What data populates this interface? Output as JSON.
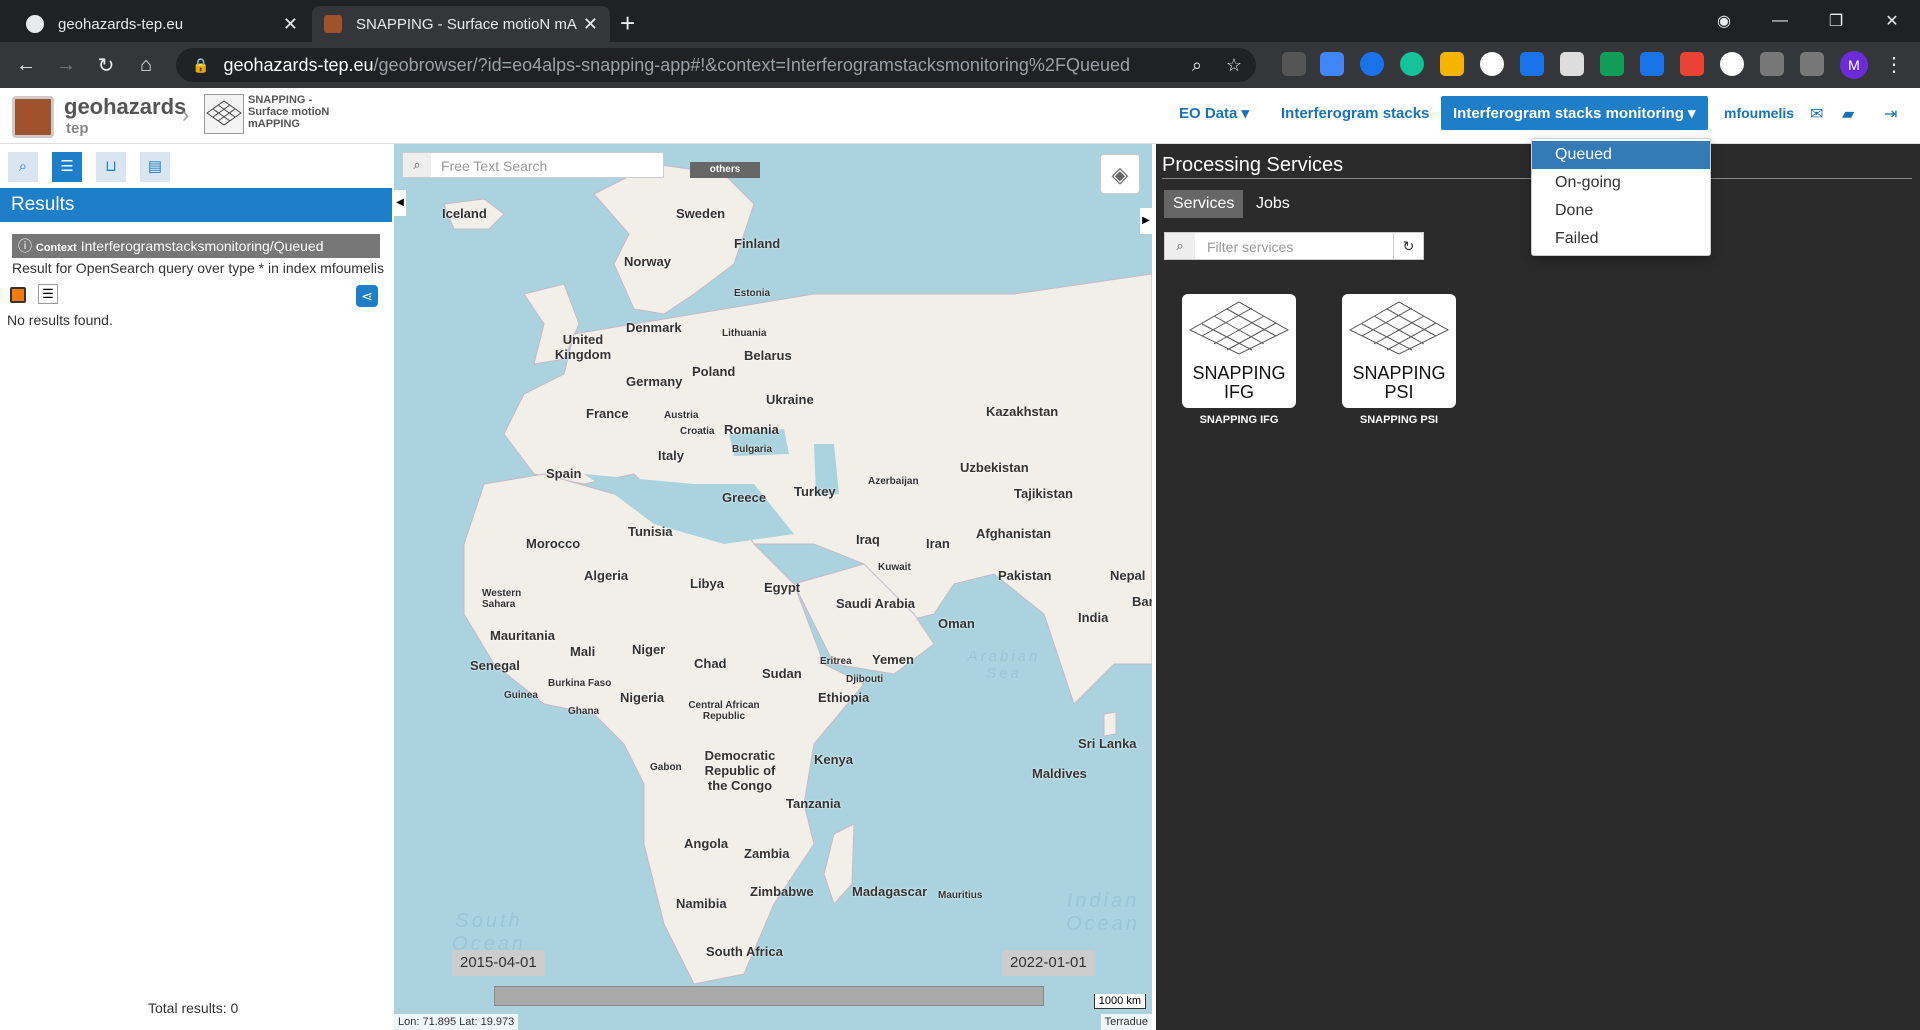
{
  "browser": {
    "tabs": [
      {
        "title": "geohazards-tep.eu"
      },
      {
        "title": "SNAPPING - Surface motioN mAI"
      }
    ],
    "url_host": "geohazards-tep.eu",
    "url_path": "/geobrowser/?id=eo4alps-snapping-app#!&context=Interferogramstacksmonitoring%2FQueued",
    "profile_initial": "M"
  },
  "header": {
    "logo_title": "geohazards",
    "logo_sub": "tep",
    "app_name_line1": "SNAPPING -",
    "app_name_line2": "Surface motioN",
    "app_name_line3": "mAPPING",
    "nav": {
      "eo_data": "EO Data ▾",
      "interferogram_stacks": "Interferogram stacks",
      "monitoring": "Interferogram stacks monitoring ▾",
      "user": "mfoumelis"
    }
  },
  "dropdown": {
    "items": [
      "Queued",
      "On-going",
      "Done",
      "Failed"
    ],
    "selected": "Queued"
  },
  "left": {
    "results_title": "Results",
    "context_prefix": "Context",
    "context_value": "Interferogramstacksmonitoring/Queued",
    "query_text": "Result for OpenSearch query over type * in index mfoumelis",
    "no_results": "No results found.",
    "total": "Total results: 0"
  },
  "map": {
    "search_placeholder": "Free Text Search",
    "others_label": "others",
    "start_date": "2015-04-01",
    "end_date": "2022-01-01",
    "scale": "1000 km",
    "coords": "Lon: 71.895 Lat: 19.973",
    "attribution": "Terradue",
    "labels": [
      "Iceland",
      "Sweden",
      "Finland",
      "Norway",
      "Estonia",
      "Denmark",
      "Lithuania",
      "United Kingdom",
      "Belarus",
      "Poland",
      "Germany",
      "Ukraine",
      "France",
      "Austria",
      "Croatia",
      "Romania",
      "Bulgaria",
      "Italy",
      "Spain",
      "Greece",
      "Turkey",
      "Tunisia",
      "Morocco",
      "Algeria",
      "Libya",
      "Egypt",
      "Iraq",
      "Iran",
      "Kuwait",
      "Saudi Arabia",
      "Oman",
      "Kazakhstan",
      "Uzbekistan",
      "Tajikistan",
      "Afghanistan",
      "Pakistan",
      "Nepal",
      "India",
      "Western Sahara",
      "Mauritania",
      "Mali",
      "Niger",
      "Chad",
      "Sudan",
      "Senegal",
      "Burkina Faso",
      "Guinea",
      "Nigeria",
      "Ghana",
      "Eritrea",
      "Djibouti",
      "Yemen",
      "Ethiopia",
      "Central African Republic",
      "Gabon",
      "Democratic Republic of the Congo",
      "Kenya",
      "Tanzania",
      "Angola",
      "Zambia",
      "Zimbabwe",
      "Namibia",
      "Madagascar",
      "Mauritius",
      "South Africa",
      "Sri Lanka",
      "Maldives",
      "Azerbaijan",
      "Bar",
      "Arabian Sea",
      "Indian Ocean",
      "South Ocean"
    ]
  },
  "right": {
    "title": "Processing Services",
    "tab_services": "Services",
    "tab_jobs": "Jobs",
    "filter_placeholder": "Filter services",
    "services": [
      {
        "card_line1": "SNAPPING",
        "card_line2": "IFG",
        "caption": "SNAPPING IFG"
      },
      {
        "card_line1": "SNAPPING",
        "card_line2": "PSI",
        "caption": "SNAPPING PSI"
      }
    ]
  }
}
